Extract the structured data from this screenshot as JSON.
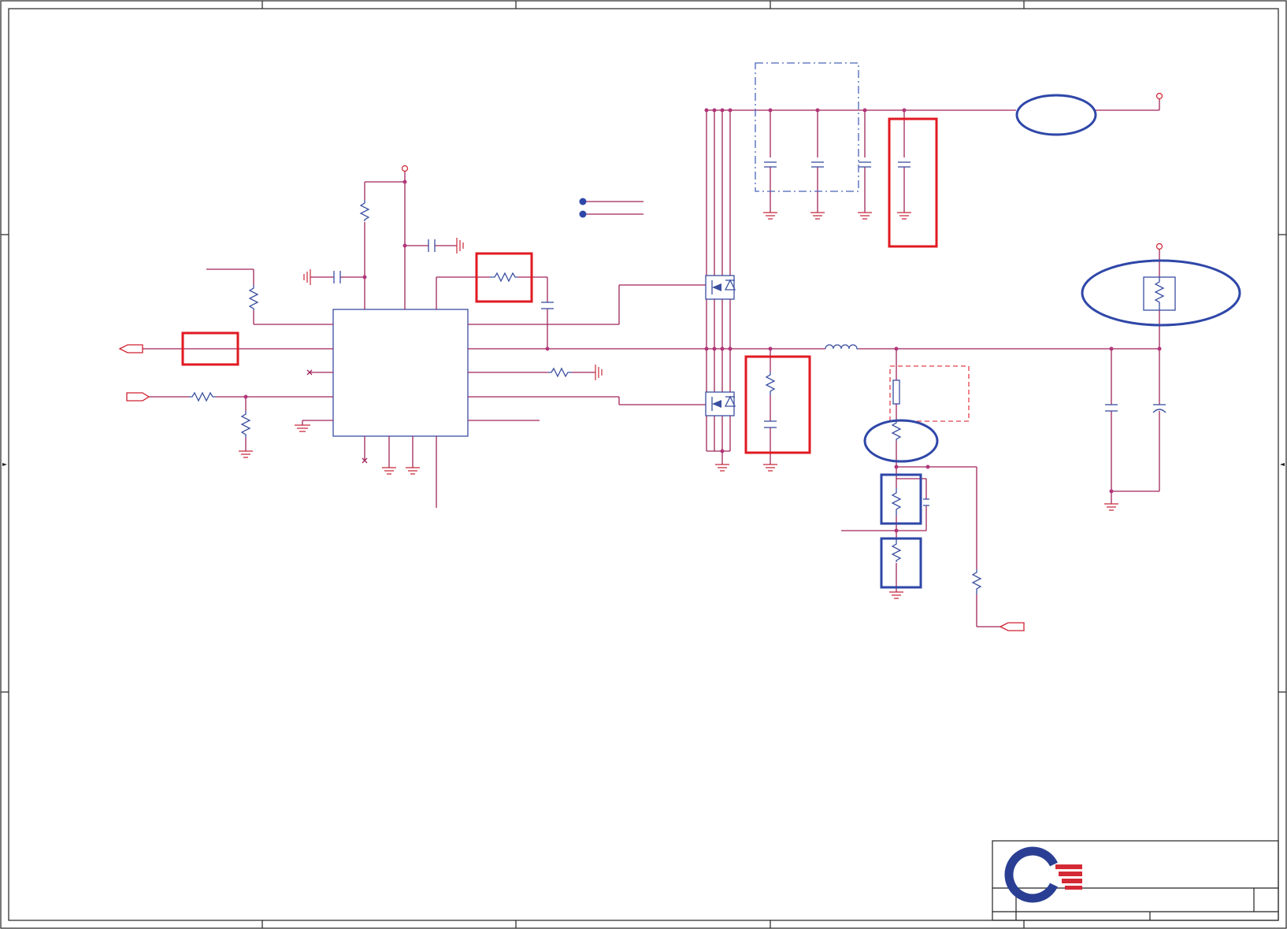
{
  "sheet": {
    "colors": {
      "wire": "#a0255a",
      "component": "#3a4fa0",
      "highlight_red": "#e01a22",
      "highlight_blue": "#2f47a8",
      "logo_blue": "#2a3f93",
      "logo_red": "#d42a36"
    },
    "title_block": {
      "logo": "company-logo-icon"
    }
  }
}
